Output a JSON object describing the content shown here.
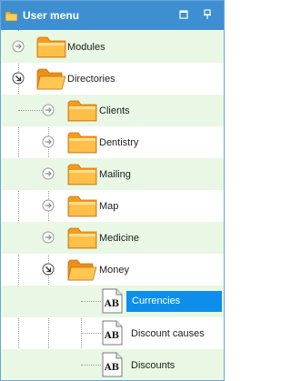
{
  "panel": {
    "title": "User menu"
  },
  "icons": {
    "title_folder": "folder-icon",
    "restore": "restore-window-icon",
    "pin": "pin-icon",
    "expand": "expand-arrow-icon",
    "collapse": "collapse-arrow-icon",
    "folder": "folder-icon",
    "open_folder": "folder-open-icon",
    "document": "ab-document-icon"
  },
  "tree": {
    "items": [
      {
        "label": "Modules",
        "state": "collapsed"
      },
      {
        "label": "Directories",
        "state": "expanded"
      },
      {
        "label": "Clients",
        "state": "collapsed"
      },
      {
        "label": "Dentistry",
        "state": "collapsed"
      },
      {
        "label": "Mailing",
        "state": "collapsed"
      },
      {
        "label": "Map",
        "state": "collapsed"
      },
      {
        "label": "Medicine",
        "state": "collapsed"
      },
      {
        "label": "Money",
        "state": "expanded"
      },
      {
        "label": "Currencies",
        "state": "selected"
      },
      {
        "label": "Discount causes",
        "state": "leaf"
      },
      {
        "label": "Discounts",
        "state": "leaf"
      }
    ]
  },
  "colors": {
    "titlebar": "#3d8fd1",
    "selection": "#0d8eea",
    "row_alt": "#e8f8e4",
    "folder": "#f5a623"
  }
}
